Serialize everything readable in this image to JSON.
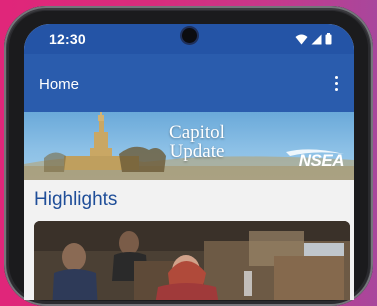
{
  "status_bar": {
    "time": "12:30"
  },
  "app_bar": {
    "title": "Home"
  },
  "banner": {
    "line1": "Capitol",
    "line2": "Update",
    "logo_text": "NSEA"
  },
  "highlights": {
    "title": "Highlights"
  },
  "colors": {
    "status_bar": "#2454a6",
    "app_bar": "#2a5cad",
    "section_title": "#1f4e99",
    "background_pink": "#e0267a"
  },
  "icons": [
    "wifi-icon",
    "signal-icon",
    "battery-icon",
    "overflow-menu-icon",
    "camera-notch"
  ]
}
